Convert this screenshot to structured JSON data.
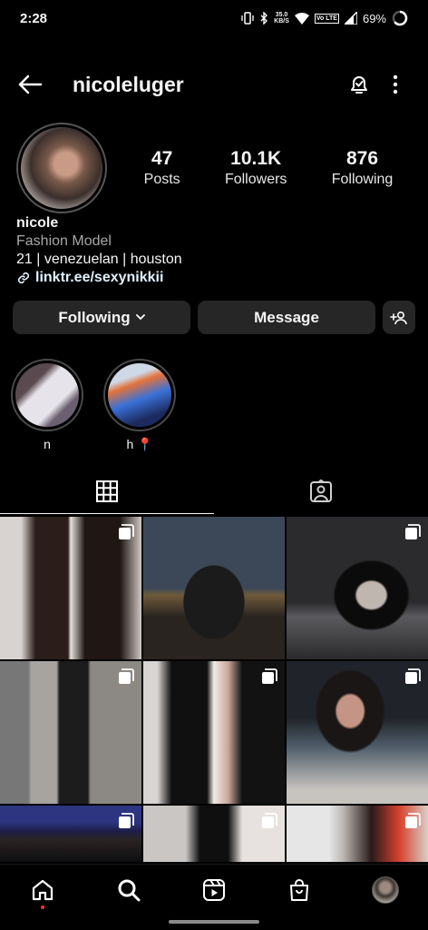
{
  "status_bar": {
    "time": "2:28",
    "net_speed_top": "35.0",
    "net_speed_bottom": "KB/S",
    "volte": "Vo LTE",
    "battery": "69%"
  },
  "header": {
    "username": "nicoleluger"
  },
  "profile": {
    "stats": [
      {
        "value": "47",
        "label": "Posts"
      },
      {
        "value": "10.1K",
        "label": "Followers"
      },
      {
        "value": "876",
        "label": "Following"
      }
    ],
    "name": "nicole",
    "category": "Fashion Model",
    "bio_line": "21 | venezuelan | houston",
    "link": "linktr.ee/sexynikkii"
  },
  "actions": {
    "following_label": "Following",
    "message_label": "Message"
  },
  "highlights": [
    {
      "label": "n"
    },
    {
      "label": "h 📍"
    }
  ],
  "tabs": [
    {
      "icon": "grid-icon"
    },
    {
      "icon": "tagged-icon"
    }
  ],
  "nav": [
    {
      "icon": "home-icon"
    },
    {
      "icon": "search-icon"
    },
    {
      "icon": "reels-icon"
    },
    {
      "icon": "shop-icon"
    },
    {
      "icon": "profile-avatar"
    }
  ],
  "colors": {
    "background": "#000000",
    "button": "#262626",
    "notification_dot": "#ff3040",
    "link": "#e0f1ff"
  }
}
